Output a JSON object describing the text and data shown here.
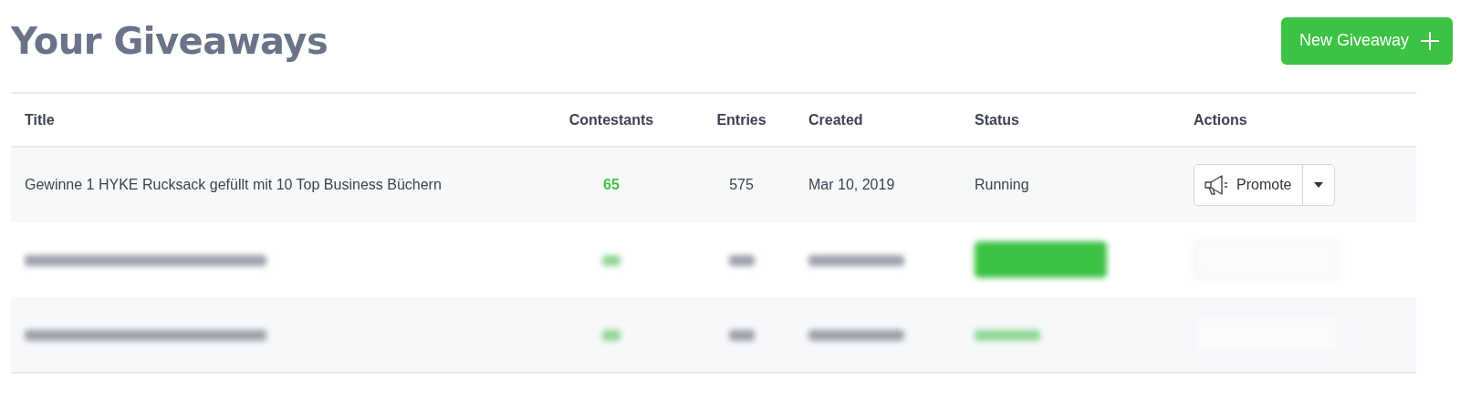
{
  "page_title": "Your Giveaways",
  "new_button": {
    "label": "New Giveaway"
  },
  "table": {
    "columns": [
      "Title",
      "Contestants",
      "Entries",
      "Created",
      "Status",
      "Actions"
    ],
    "rows": [
      {
        "kind": "plain",
        "title": "Gewinne 1 HYKE Rucksack gefüllt mit 10 Top Business Büchern",
        "contestants": "65",
        "entries": "575",
        "created": "Mar 10, 2019",
        "status": "Running",
        "action": "Promote"
      },
      {
        "kind": "blurred_badge"
      },
      {
        "kind": "blurred_text"
      }
    ]
  }
}
